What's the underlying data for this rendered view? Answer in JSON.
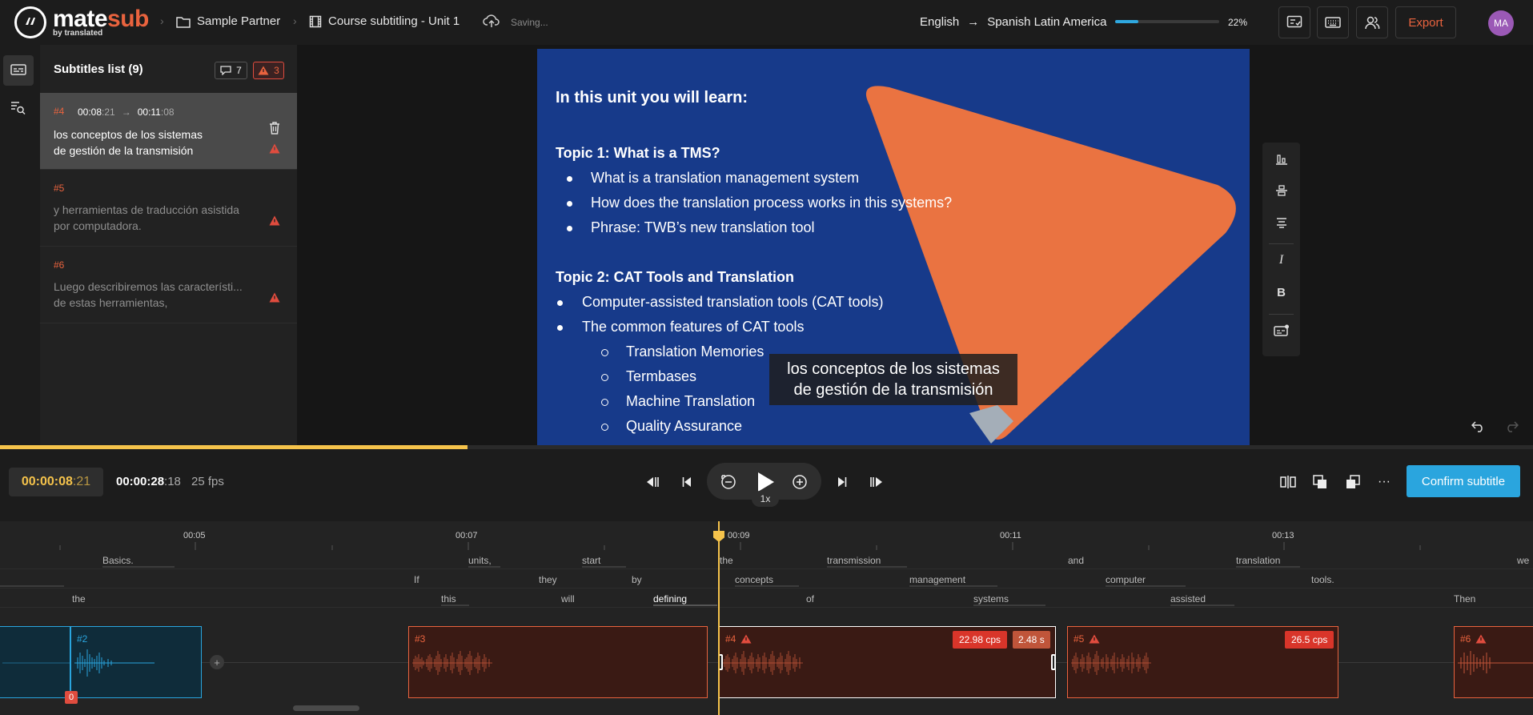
{
  "app": {
    "logo_main": "mate",
    "logo_accent": "sub",
    "logo_by": "by translated"
  },
  "breadcrumb": {
    "partner": "Sample Partner",
    "project": "Course subtitling - Unit 1",
    "status": "Saving..."
  },
  "language": {
    "source": "English",
    "target": "Spanish Latin America",
    "progress_pct": 22,
    "progress_label": "22%"
  },
  "toolbar": {
    "export_label": "Export",
    "avatar_initials": "MA"
  },
  "subtitles_panel": {
    "title": "Subtitles list (9)",
    "comments_count": "7",
    "warnings_count": "3",
    "items": [
      {
        "num": "#4",
        "start_main": "00:08",
        "start_frac": ":21",
        "end_main": "00:11",
        "end_frac": ":08",
        "line1": "los conceptos de los sistemas",
        "line2": "de gestión de la transmisión",
        "active": true
      },
      {
        "num": "#5",
        "line1": "y herramientas de traducción asistida",
        "line2": "por computadora."
      },
      {
        "num": "#6",
        "line1": "Luego describiremos las característi...",
        "line2": "de estas herramientas,"
      }
    ]
  },
  "slide": {
    "heading": "In this unit you will learn:",
    "topic1": "Topic 1: What is a TMS?",
    "t1_items": [
      "What is a translation management system",
      "How does the translation process works in this systems?",
      "Phrase: TWB’s new translation tool"
    ],
    "topic2": "Topic 2: CAT Tools and Translation",
    "t2_items": [
      "Computer-assisted translation tools (CAT tools)",
      "The common features of CAT tools"
    ],
    "t2_sub": [
      "Translation Memories",
      "Termbases",
      "Machine Translation",
      "Quality Assurance"
    ]
  },
  "caption": {
    "line1": "los conceptos de los sistemas",
    "line2": "de gestión de la transmisión"
  },
  "player": {
    "current_main": "00:00:08",
    "current_frac": ":21",
    "total_main": "00:00:28",
    "total_frac": ":18",
    "fps": "25 fps",
    "rate": "1x",
    "confirm_label": "Confirm subtitle",
    "scrub_pct": 30.5
  },
  "timeline": {
    "ticks": [
      "00:05",
      "00:07",
      "00:09",
      "00:11",
      "00:13"
    ],
    "words_row1": [
      "Basics.",
      "units,",
      "start",
      "the",
      "transmission",
      "and",
      "translation",
      "we"
    ],
    "words_row2": [
      "If",
      "they",
      "by",
      "concepts",
      "management",
      "computer",
      "tools."
    ],
    "words_row3": [
      "the",
      "this",
      "will",
      "defining",
      "of",
      "systems",
      "assisted",
      "Then"
    ],
    "segments": [
      {
        "label": "#2"
      },
      {
        "label": "#3"
      },
      {
        "label": "#4",
        "cps": "22.98 cps",
        "dur": "2.48 s"
      },
      {
        "label": "#5",
        "cps": "26.5 cps"
      },
      {
        "label": "#6"
      }
    ],
    "zero_badge": "0"
  }
}
